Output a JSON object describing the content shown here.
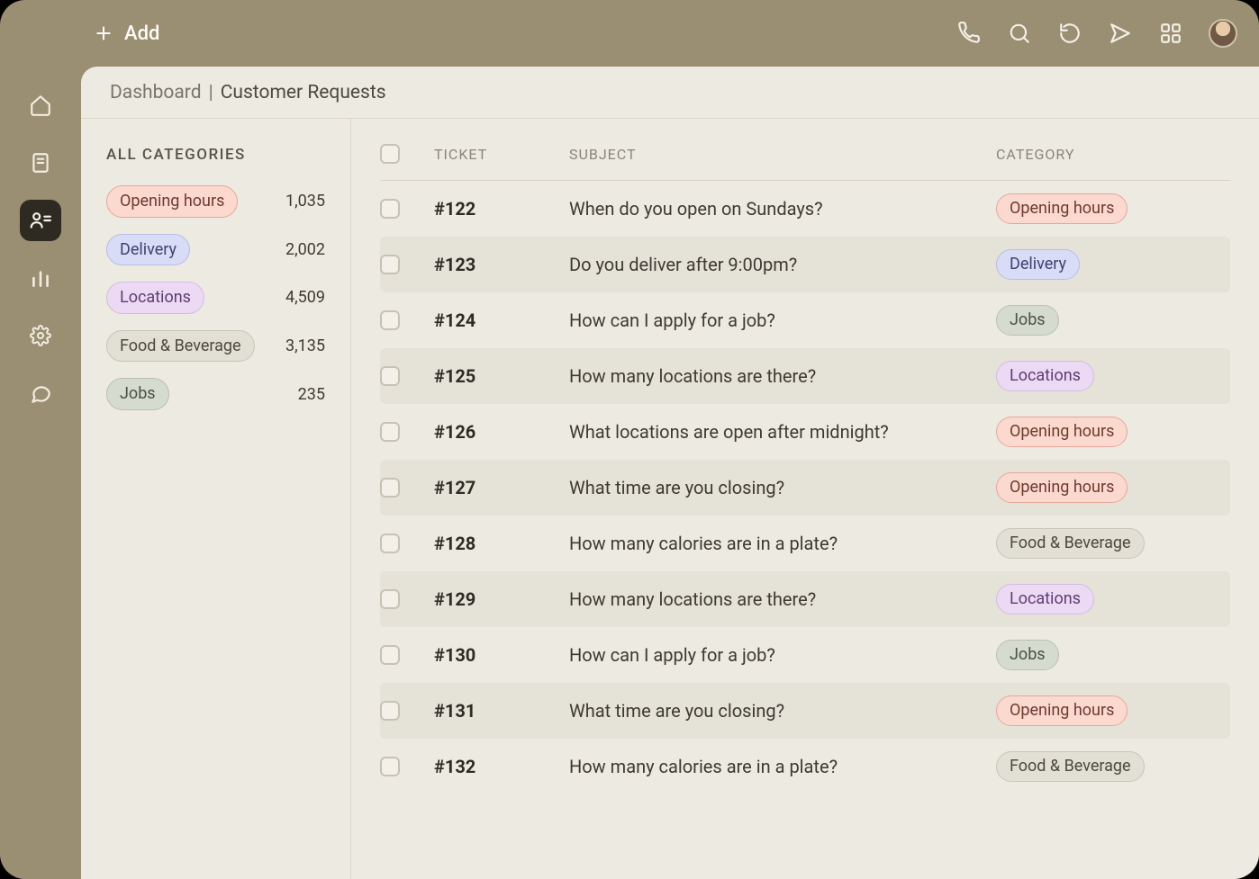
{
  "topbar": {
    "add_label": "Add"
  },
  "breadcrumb": {
    "root": "Dashboard",
    "current": "Customer Requests"
  },
  "categories_title": "ALL CATEGORIES",
  "categories": [
    {
      "label": "Opening hours",
      "count": "1,035",
      "cls": "cat-opening"
    },
    {
      "label": "Delivery",
      "count": "2,002",
      "cls": "cat-delivery"
    },
    {
      "label": "Locations",
      "count": "4,509",
      "cls": "cat-locations"
    },
    {
      "label": "Food & Beverage",
      "count": "3,135",
      "cls": "cat-food"
    },
    {
      "label": "Jobs",
      "count": "235",
      "cls": "cat-jobs"
    }
  ],
  "table": {
    "headers": {
      "ticket": "TICKET",
      "subject": "SUBJECT",
      "category": "CATEGORY"
    },
    "rows": [
      {
        "id": "#122",
        "subject": "When do you open on Sundays?",
        "cat": "Opening hours",
        "cls": "cat-opening"
      },
      {
        "id": "#123",
        "subject": "Do you deliver after 9:00pm?",
        "cat": "Delivery",
        "cls": "cat-delivery"
      },
      {
        "id": "#124",
        "subject": "How can I apply for a job?",
        "cat": "Jobs",
        "cls": "cat-jobs"
      },
      {
        "id": "#125",
        "subject": "How many locations are there?",
        "cat": "Locations",
        "cls": "cat-locations"
      },
      {
        "id": "#126",
        "subject": "What locations are open after midnight?",
        "cat": "Opening hours",
        "cls": "cat-opening"
      },
      {
        "id": "#127",
        "subject": "What time are you closing?",
        "cat": "Opening hours",
        "cls": "cat-opening"
      },
      {
        "id": "#128",
        "subject": "How many calories are in a plate?",
        "cat": "Food & Beverage",
        "cls": "cat-food"
      },
      {
        "id": "#129",
        "subject": "How many locations are there?",
        "cat": "Locations",
        "cls": "cat-locations"
      },
      {
        "id": "#130",
        "subject": "How can I apply for a job?",
        "cat": "Jobs",
        "cls": "cat-jobs"
      },
      {
        "id": "#131",
        "subject": "What time are you closing?",
        "cat": "Opening hours",
        "cls": "cat-opening"
      },
      {
        "id": "#132",
        "subject": "How many calories are in a plate?",
        "cat": "Food & Beverage",
        "cls": "cat-food"
      }
    ]
  }
}
